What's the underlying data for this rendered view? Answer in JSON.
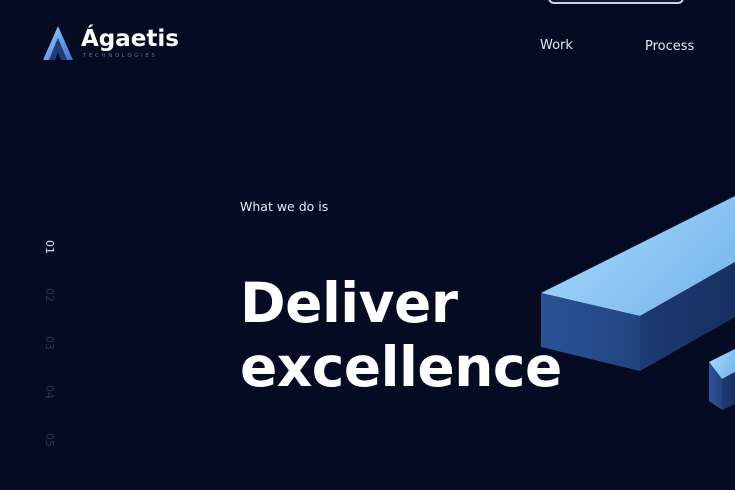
{
  "brand": {
    "name": "Ágaetis",
    "tagline": "TECHNOLOGIES"
  },
  "nav": {
    "items": [
      {
        "label": "Work"
      },
      {
        "label": "Process"
      }
    ]
  },
  "side_nav": {
    "items": [
      "01",
      "02",
      "03",
      "04",
      "05"
    ],
    "active_index": 0
  },
  "hero": {
    "eyebrow": "What we do is",
    "headline_line1": "Deliver",
    "headline_line2": "excellence"
  },
  "colors": {
    "background": "#060b24",
    "accent_light": "#8ec8f2",
    "accent_dark": "#1f3e78",
    "text": "#ffffff",
    "muted": "#2c3552"
  }
}
